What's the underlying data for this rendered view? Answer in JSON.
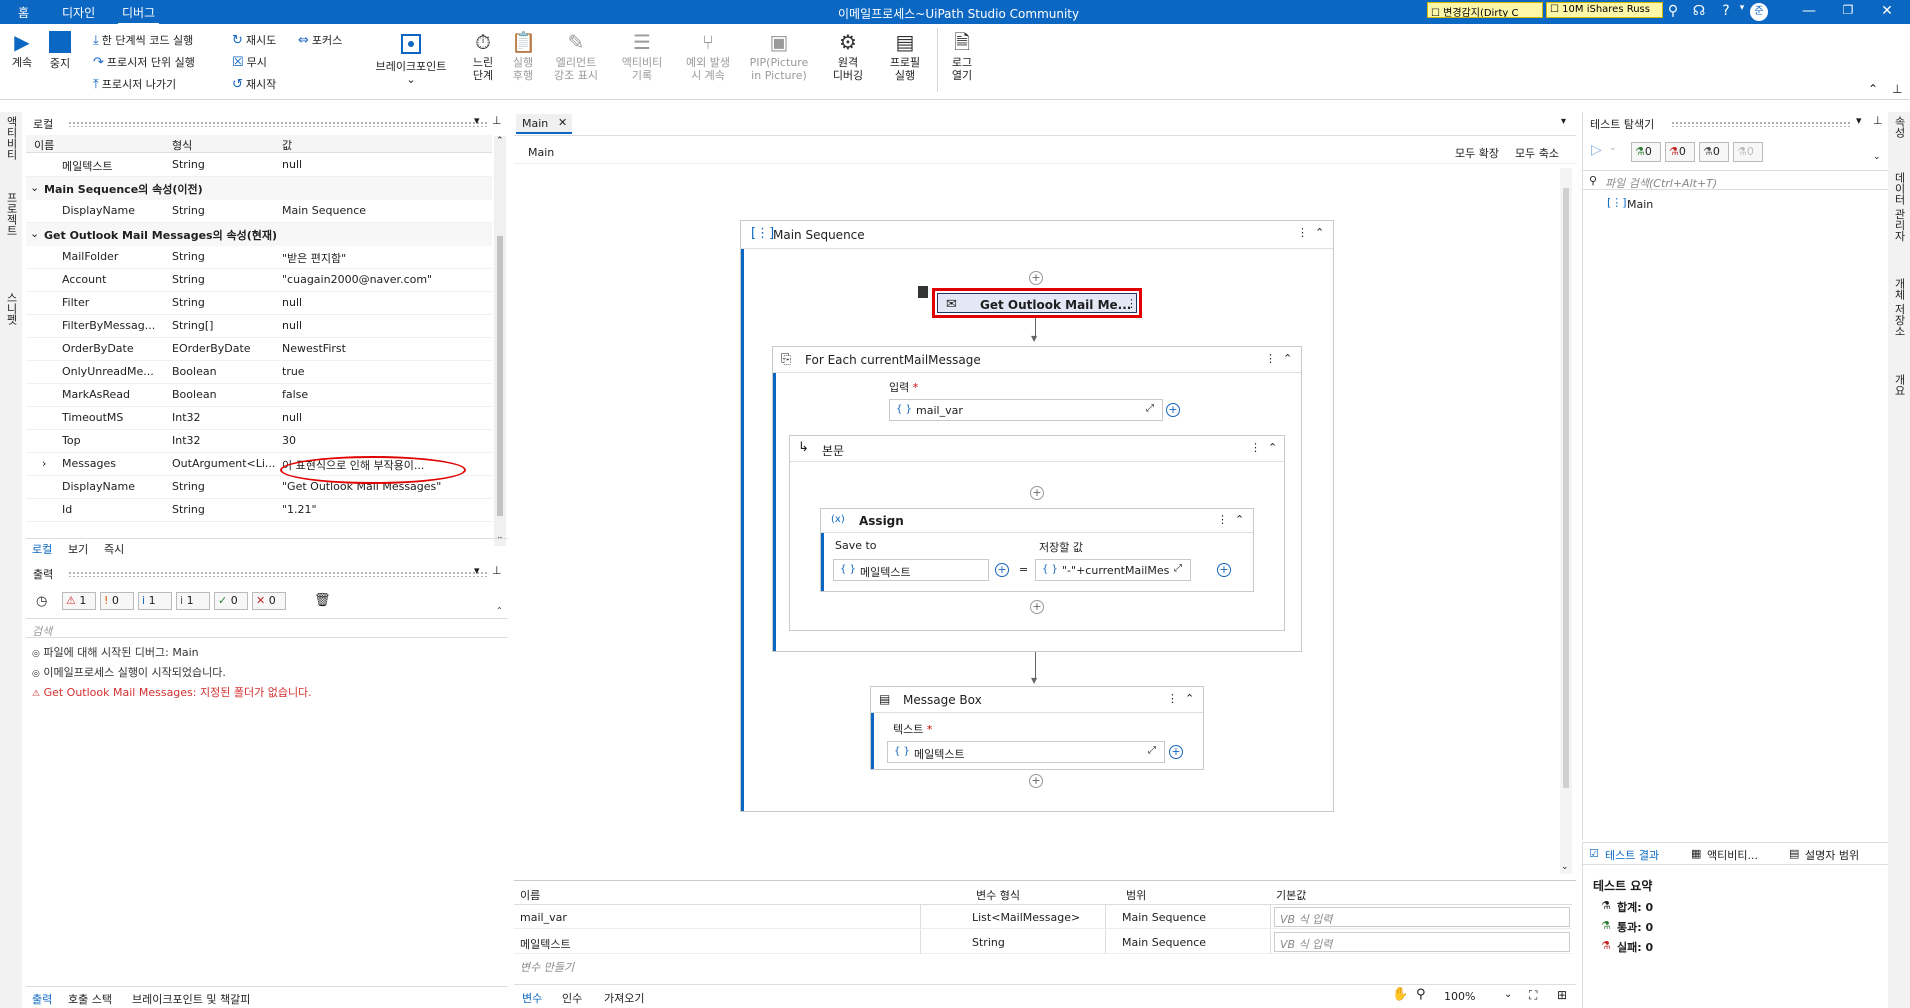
{
  "titlebar": {
    "tabs": [
      "홈",
      "디자인",
      "디버그"
    ],
    "title": "이메일프로세스~UiPath Studio Community",
    "checks": [
      "변경감지(Dirty C",
      "10M iShares Russ"
    ],
    "user": "준터"
  },
  "ribbon": {
    "continue": "계속",
    "stop": "중지",
    "step_into": "한 단계씩 코드 실행",
    "step_over": "프로시저 단위 실행",
    "step_out": "프로시저 나가기",
    "retry": "재시도",
    "ignore": "무시",
    "restart": "재시작",
    "focus": "포커스",
    "breakpoints": "브레이크포인트",
    "slow_step": "느린\n단계",
    "execution_trail": "실행\n후행",
    "highlight": "엘리먼트\n강조 표시",
    "log_activities": "액티비티\n기록",
    "break_on_exception": "예외 발생\n시 계속",
    "pip": "PIP(Picture\nin Picture)",
    "remote_debug": "원격\n디버깅",
    "profile": "프로필\n실행",
    "open_logs": "로그\n열기"
  },
  "left_strip": [
    "액티비티",
    "프로젝트",
    "스니펫"
  ],
  "right_strip": [
    "속성",
    "데이터 관리자",
    "개체 저장소",
    "개요"
  ],
  "locals": {
    "title": "로컬",
    "columns": [
      "이름",
      "형식",
      "값"
    ],
    "rows": [
      {
        "kind": "row",
        "name": "메일텍스트",
        "type": "String",
        "value": "null"
      },
      {
        "kind": "section",
        "name": "Main Sequence의 속성(이전)"
      },
      {
        "kind": "row",
        "name": "DisplayName",
        "type": "String",
        "value": "Main Sequence"
      },
      {
        "kind": "section",
        "name": "Get Outlook Mail Messages의 속성(현재)"
      },
      {
        "kind": "row",
        "name": "MailFolder",
        "type": "String",
        "value": "\"받은 편지함\""
      },
      {
        "kind": "row",
        "name": "Account",
        "type": "String",
        "value": "\"cuagain2000@naver.com\""
      },
      {
        "kind": "row",
        "name": "Filter",
        "type": "String",
        "value": "null"
      },
      {
        "kind": "row",
        "name": "FilterByMessag...",
        "type": "String[]",
        "value": "null"
      },
      {
        "kind": "row",
        "name": "OrderByDate",
        "type": "EOrderByDate",
        "value": "NewestFirst"
      },
      {
        "kind": "row",
        "name": "OnlyUnreadMe...",
        "type": "Boolean",
        "value": "true"
      },
      {
        "kind": "row",
        "name": "MarkAsRead",
        "type": "Boolean",
        "value": "false"
      },
      {
        "kind": "row",
        "name": "TimeoutMS",
        "type": "Int32",
        "value": "null"
      },
      {
        "kind": "row",
        "name": "Top",
        "type": "Int32",
        "value": "30"
      },
      {
        "kind": "row",
        "name": "Messages",
        "type": "OutArgument<Li...",
        "value": "이 표현식으로 인해 부작용이...",
        "expand": "›"
      },
      {
        "kind": "row",
        "name": "DisplayName",
        "type": "String",
        "value": "\"Get Outlook Mail Messages\""
      },
      {
        "kind": "row",
        "name": "Id",
        "type": "String",
        "value": "\"1.21\""
      }
    ],
    "tabs": [
      "로컬",
      "보기",
      "즉시"
    ]
  },
  "output": {
    "title": "출력",
    "filters": [
      "1",
      "0",
      "1",
      "1",
      "0",
      "0"
    ],
    "search_placeholder": "검색",
    "lines": [
      {
        "text": "파일에 대해 시작된 디버그: Main",
        "color": "#333333"
      },
      {
        "text": "이메일프로세스 실행이 시작되었습니다.",
        "color": "#333333"
      },
      {
        "text": "Get Outlook Mail Messages: 지정된 폴더가 없습니다.",
        "color": "#d32f2f"
      }
    ],
    "tabs": [
      "출력",
      "호출 스택",
      "브레이크포인트 및 책갈피"
    ]
  },
  "designer": {
    "tab": "Main",
    "breadcrumb": "Main",
    "expand_all": "모두 확장",
    "collapse_all": "모두 축소",
    "main_sequence": "Main Sequence",
    "get_outlook": "Get Outlook Mail Me...",
    "foreach": "For Each currentMailMessage",
    "input_label": "입력",
    "input_value": "mail_var",
    "body": "본문",
    "assign": "Assign",
    "save_to": "Save to",
    "value_to_save": "저장할 값",
    "assign_to": "메일텍스트",
    "assign_value": "\"-\"+currentMailMessa",
    "msgbox": "Message Box",
    "text_label": "텍스트",
    "text_value": "메일텍스트"
  },
  "variables": {
    "columns": [
      "이름",
      "변수 형식",
      "범위",
      "기본값"
    ],
    "rows": [
      {
        "name": "mail_var",
        "type": "List<MailMessage>",
        "scope": "Main Sequence",
        "default": "VB 식 입력"
      },
      {
        "name": "메일텍스트",
        "type": "String",
        "scope": "Main Sequence",
        "default": "VB 식 입력"
      }
    ],
    "create": "변수 만들기",
    "tabs": [
      "변수",
      "인수",
      "가져오기"
    ],
    "zoom": "100%"
  },
  "test_explorer": {
    "title": "테스트 탐색기",
    "counts": [
      "0",
      "0",
      "0",
      "0"
    ],
    "search_placeholder": "파일 검색(Ctrl+Alt+T)",
    "tree_item": "Main",
    "tabs": [
      "테스트 결과",
      "액티비티...",
      "설명자 범위"
    ],
    "summary_title": "테스트 요약",
    "summary": [
      "합계: 0",
      "통과: 0",
      "실패: 0"
    ]
  }
}
